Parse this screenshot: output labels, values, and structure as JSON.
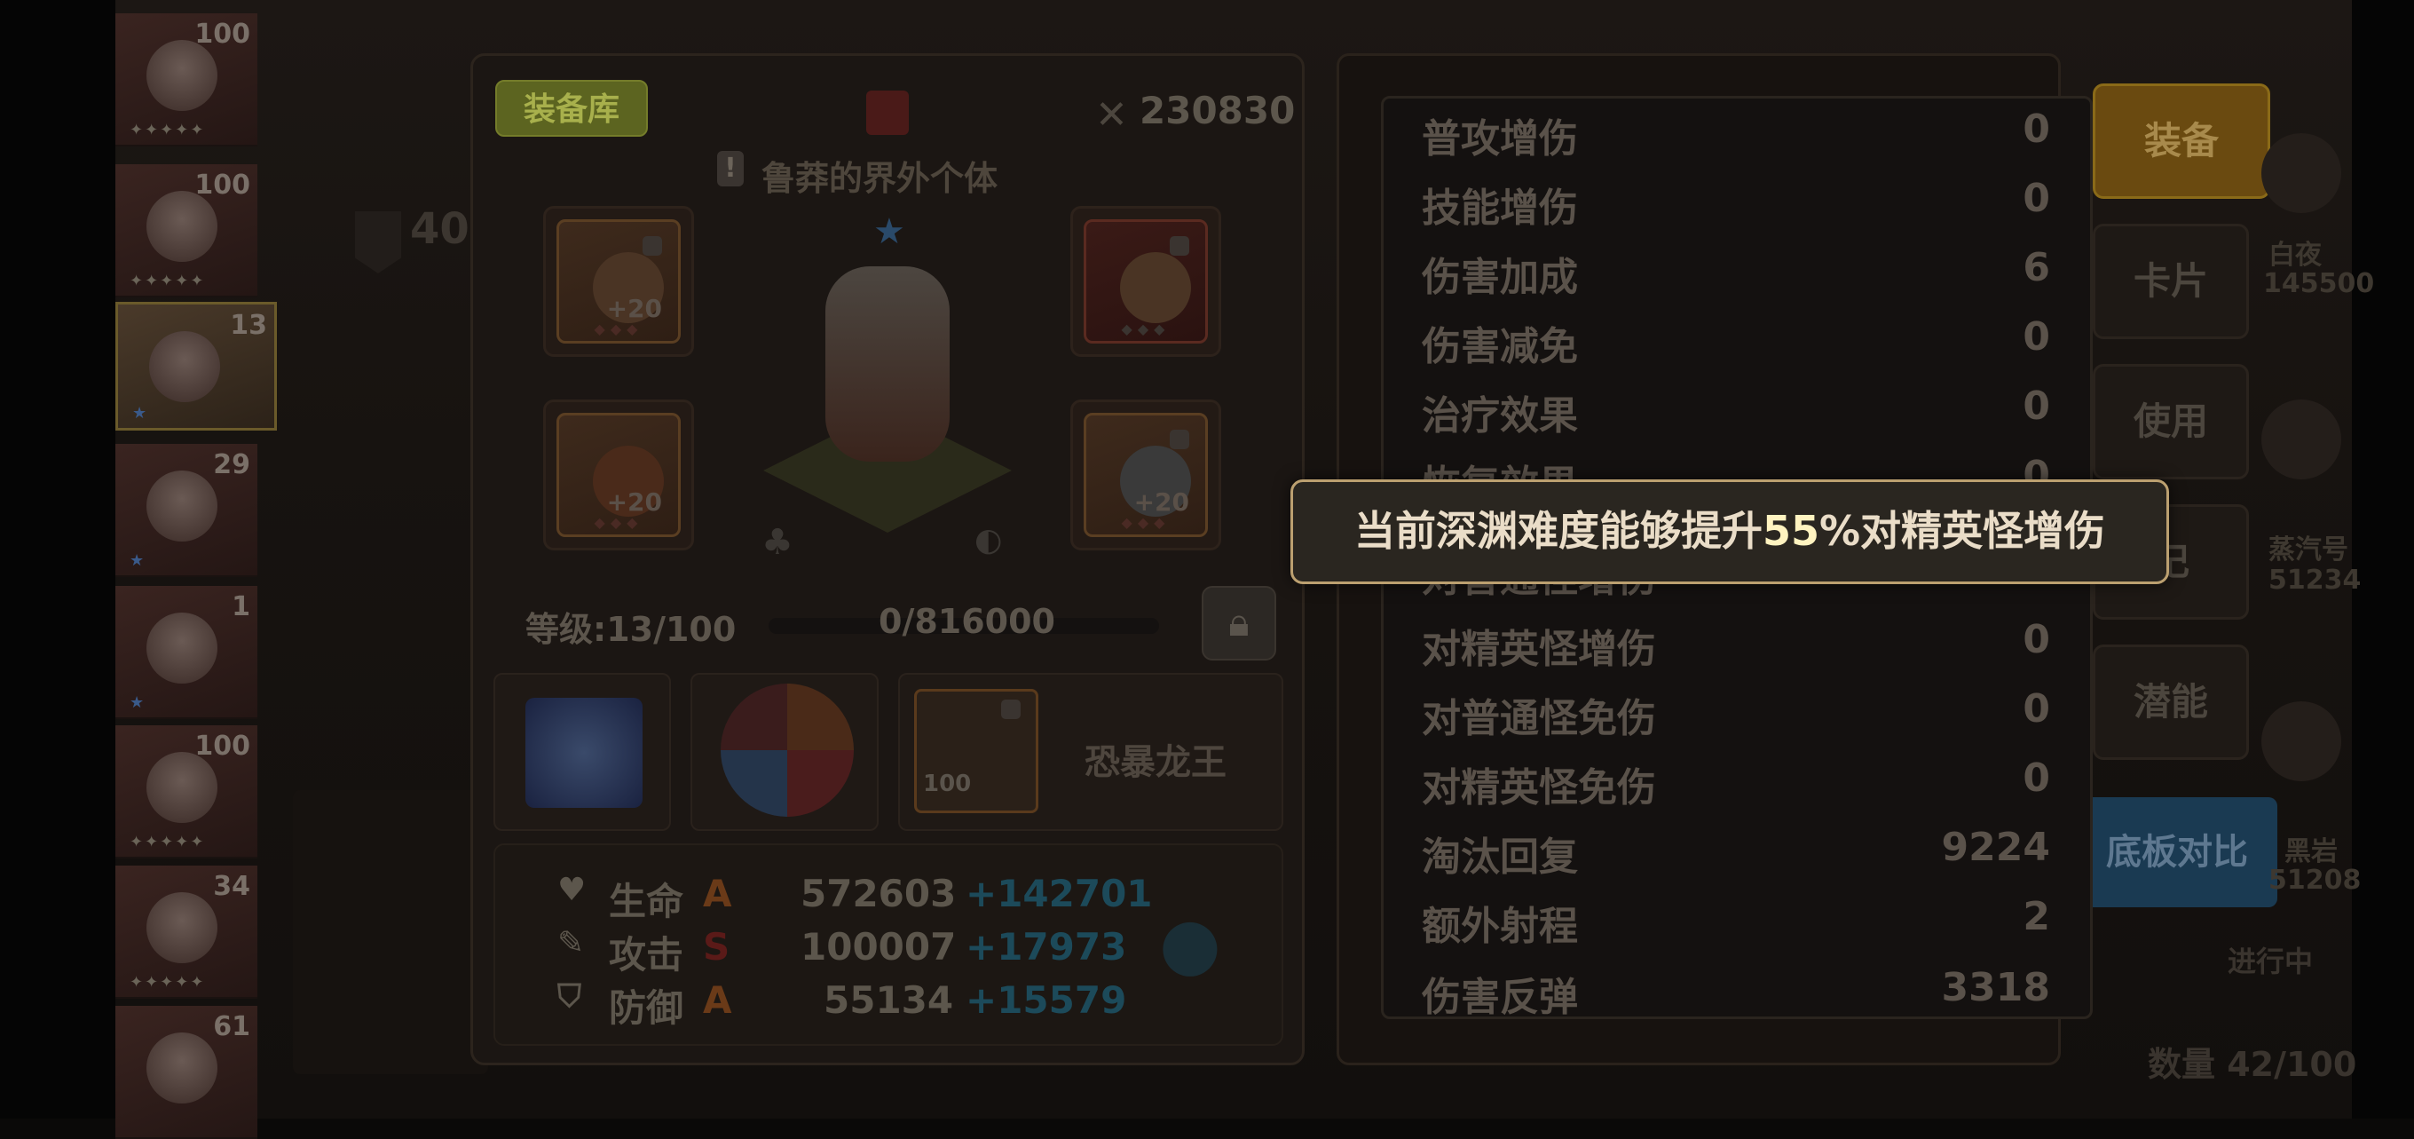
{
  "roster": [
    {
      "level": "100",
      "stars": "✦✦✦✦✦"
    },
    {
      "level": "100",
      "stars": "✦✦✦✦✦"
    },
    {
      "level": "13",
      "stars": "★",
      "selected": true
    },
    {
      "level": "29",
      "stars": "★"
    },
    {
      "level": "1",
      "stars": "★"
    },
    {
      "level": "100",
      "stars": "✦✦✦✦✦"
    },
    {
      "level": "34",
      "stars": "✦✦✦✦✦"
    },
    {
      "level": "61",
      "stars": ""
    }
  ],
  "background": {
    "rank_number": "40"
  },
  "equipment": {
    "armory_label": "装备库",
    "combat_power": "230830",
    "hero_title": "鲁莽的界外个体",
    "title_warning": "!",
    "slots": [
      {
        "name": "bow",
        "plus": "+20"
      },
      {
        "name": "ring",
        "plus": ""
      },
      {
        "name": "armor",
        "plus": "+20"
      },
      {
        "name": "necklace",
        "plus": "+20"
      }
    ],
    "level_text": "等级:13/100",
    "exp_text": "0/816000",
    "exp_fraction": 0.0,
    "card": {
      "level": "100",
      "name": "恐暴龙王"
    },
    "stats": [
      {
        "label": "生命",
        "grade": "A",
        "value": "572603",
        "bonus": "+142701",
        "icon": "heart-icon"
      },
      {
        "label": "攻击",
        "grade": "S",
        "value": "100007",
        "bonus": "+17973",
        "icon": "sword-icon"
      },
      {
        "label": "防御",
        "grade": "A",
        "value": "55134",
        "bonus": "+15579",
        "icon": "shield-icon"
      }
    ]
  },
  "attributes": [
    {
      "label": "普攻增伤",
      "value": "0"
    },
    {
      "label": "技能增伤",
      "value": "0"
    },
    {
      "label": "伤害加成",
      "value": "6"
    },
    {
      "label": "伤害减免",
      "value": "0"
    },
    {
      "label": "治疗效果",
      "value": "0"
    },
    {
      "label": "恢复效果",
      "value": "0"
    },
    {
      "label": "对普通怪增伤",
      "value": "0"
    },
    {
      "label": "对精英怪增伤",
      "value": "0"
    },
    {
      "label": "对普通怪免伤",
      "value": "0"
    },
    {
      "label": "对精英怪免伤",
      "value": "0"
    },
    {
      "label": "淘汰回复",
      "value": "9224"
    },
    {
      "label": "额外射程",
      "value": "2"
    },
    {
      "label": "伤害反弹",
      "value": "3318"
    }
  ],
  "side_buttons": [
    "装备",
    "卡片",
    "使用",
    "记",
    "潜能"
  ],
  "compare_button": "底板对比",
  "right_column": [
    {
      "name": "白夜",
      "power": "145500"
    },
    {
      "name": "蒸汽号",
      "power": "51234"
    },
    {
      "name": "黑岩",
      "power": "51208"
    }
  ],
  "progress_label": "进行中",
  "count_text": "数量 42/100",
  "tooltip": {
    "prefix": "当前深渊难度能够提升",
    "highlight": "55",
    "suffix": "%对精英怪增伤"
  },
  "colors": {
    "tooltip_border": "#bca070",
    "tooltip_bg": "#2a2620",
    "active_button": "#6a4a10"
  }
}
